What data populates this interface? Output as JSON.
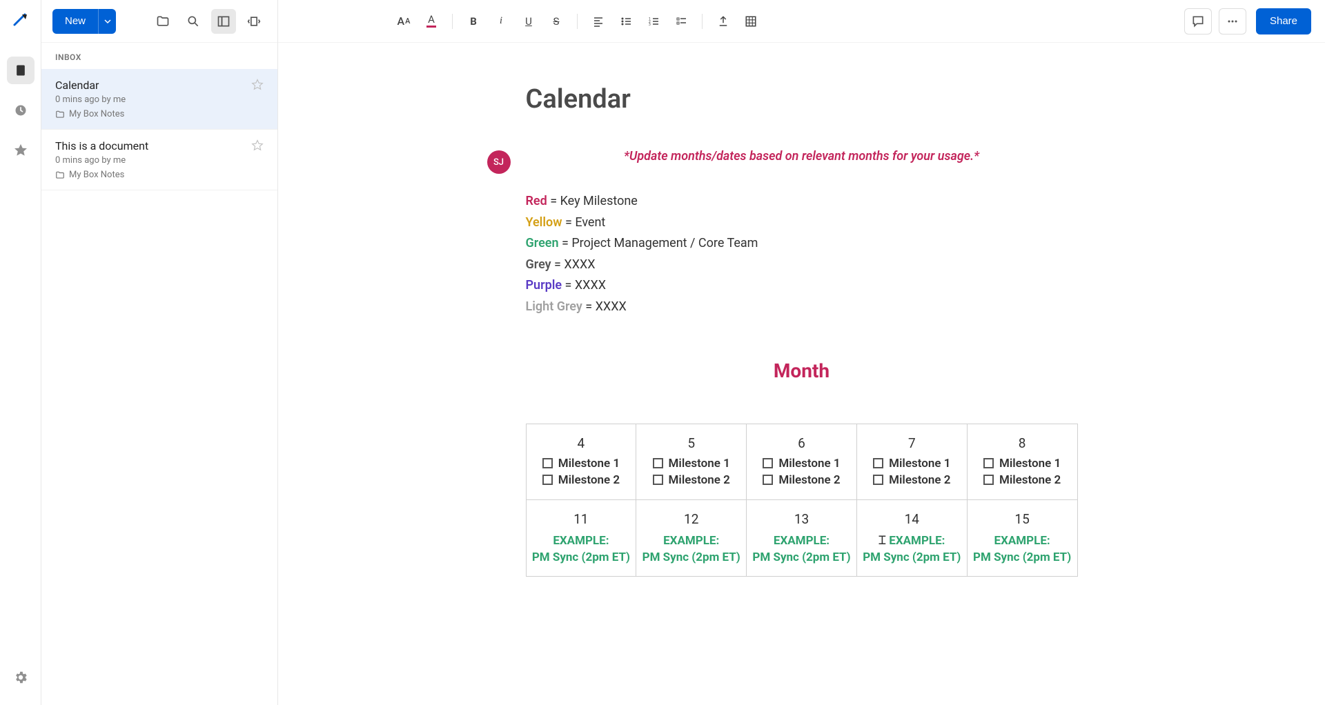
{
  "left_rail": {
    "items": [
      "documents",
      "recent",
      "favorites"
    ]
  },
  "sidebar": {
    "new_label": "New",
    "section_label": "INBOX",
    "notes": [
      {
        "title": "Calendar",
        "meta": "0 mins ago by me",
        "folder": "My Box Notes",
        "selected": true
      },
      {
        "title": "This is a document",
        "meta": "0 mins ago by me",
        "folder": "My Box Notes",
        "selected": false
      }
    ]
  },
  "toolbar": {
    "share_label": "Share"
  },
  "document": {
    "title": "Calendar",
    "avatar": "SJ",
    "update_note": "*Update months/dates based on relevant months for your usage.*",
    "legend": [
      {
        "color": "red",
        "label": "Red",
        "desc": "Key Milestone"
      },
      {
        "color": "yellow",
        "label": "Yellow",
        "desc": "Event"
      },
      {
        "color": "green",
        "label": "Green",
        "desc": "Project Management / Core Team"
      },
      {
        "color": "grey",
        "label": "Grey",
        "desc": "XXXX"
      },
      {
        "color": "purple",
        "label": "Purple",
        "desc": "XXXX"
      },
      {
        "color": "lightgrey",
        "label": "Light Grey",
        "desc": "XXXX"
      }
    ],
    "month_label": "Month",
    "row1": [
      {
        "date": "4",
        "items": [
          "Milestone 1",
          "Milestone 2"
        ]
      },
      {
        "date": "5",
        "items": [
          "Milestone 1",
          "Milestone 2"
        ]
      },
      {
        "date": "6",
        "items": [
          "Milestone 1",
          "Milestone 2"
        ]
      },
      {
        "date": "7",
        "items": [
          "Milestone 1",
          "Milestone 2"
        ]
      },
      {
        "date": "8",
        "items": [
          "Milestone 1",
          "Milestone 2"
        ]
      }
    ],
    "row2": [
      {
        "date": "11",
        "example_label": "EXAMPLE:",
        "example_text": "PM Sync (2pm ET)"
      },
      {
        "date": "12",
        "example_label": "EXAMPLE:",
        "example_text": "PM Sync (2pm ET)"
      },
      {
        "date": "13",
        "example_label": "EXAMPLE:",
        "example_text": "PM Sync (2pm ET)"
      },
      {
        "date": "14",
        "example_label": "EXAMPLE:",
        "example_text": "PM Sync (2pm ET)",
        "cursor": true
      },
      {
        "date": "15",
        "example_label": "EXAMPLE:",
        "example_text": "PM Sync (2pm ET)"
      }
    ]
  }
}
